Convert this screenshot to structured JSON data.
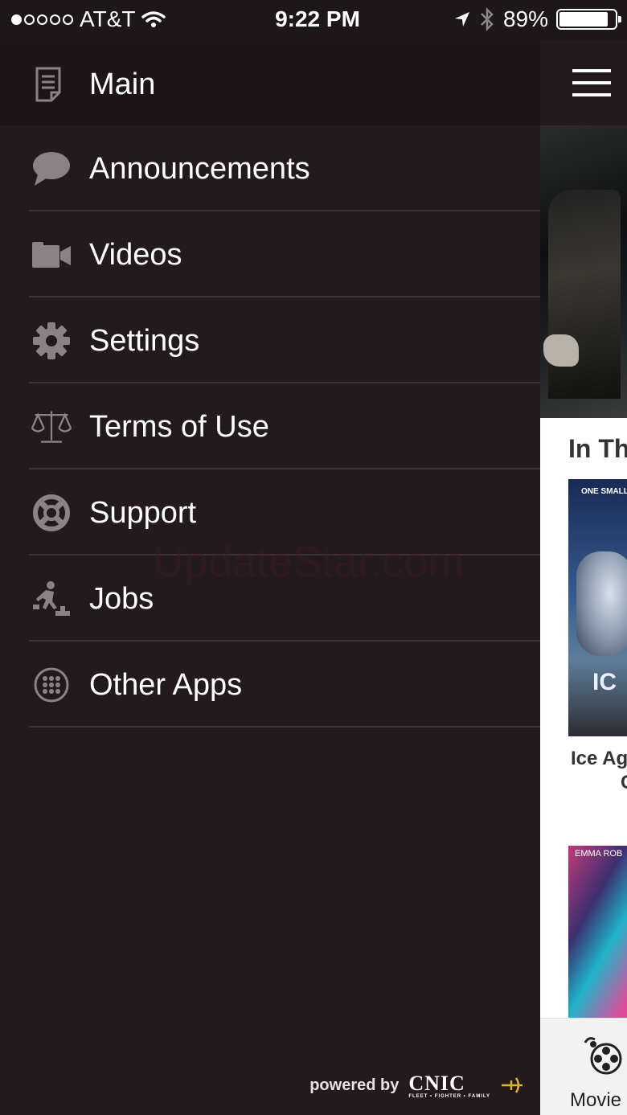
{
  "status_bar": {
    "carrier": "AT&T",
    "time": "9:22 PM",
    "battery": "89%",
    "battery_level": 0.89,
    "signal_bars": 1
  },
  "drawer": {
    "header": {
      "title": "Main",
      "icon": "document-icon"
    },
    "items": [
      {
        "label": "Announcements",
        "icon": "speech-bubble-icon"
      },
      {
        "label": "Videos",
        "icon": "video-camera-icon"
      },
      {
        "label": "Settings",
        "icon": "gear-icon"
      },
      {
        "label": "Terms of Use",
        "icon": "scales-icon"
      },
      {
        "label": "Support",
        "icon": "lifebuoy-icon"
      },
      {
        "label": "Jobs",
        "icon": "climbing-stairs-icon"
      },
      {
        "label": "Other Apps",
        "icon": "apps-grid-icon"
      }
    ],
    "footer": {
      "powered_by": "powered by",
      "brand": "CNIC",
      "brand_tagline": "FLEET • FIGHTER • FAMILY"
    }
  },
  "content": {
    "section_title": "In Th",
    "poster1": {
      "tag": "ONE SMALL",
      "title_fragment": "IC",
      "caption": "Ice Ag",
      "caption2": "C"
    },
    "poster2": {
      "tag": "EMMA ROB"
    },
    "tab": {
      "label": "Movie",
      "icon": "film-reel-icon"
    }
  },
  "watermark": "UpdateStar.com",
  "colors": {
    "drawer_bg": "#231a1d",
    "header_bg": "#1d1517",
    "divider": "#3d3337",
    "icon": "#8a8285"
  }
}
